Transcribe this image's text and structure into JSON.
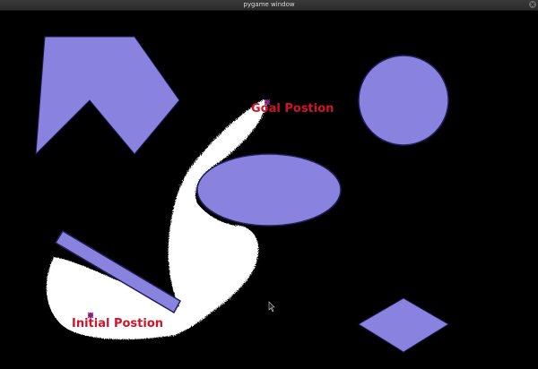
{
  "window": {
    "title": "pygame window"
  },
  "colors": {
    "background": "#000000",
    "obstacle": "#8a82df",
    "obstacle_outline": "#20205a",
    "explored_region": "#ffffff",
    "label_text": "#d2142b",
    "marker": "#3a2de0",
    "titlebar": "#2f2f2f"
  },
  "labels": {
    "goal": "Goal Postion",
    "start": "Initial Postion"
  },
  "icons": {
    "close": "close-icon",
    "cursor": "mouse-cursor-icon",
    "start_marker": "start-marker-icon",
    "goal_marker": "goal-marker-icon"
  }
}
